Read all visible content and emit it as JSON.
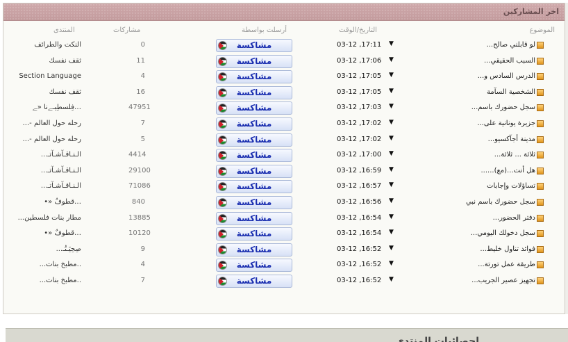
{
  "panel": {
    "title": "اخر المشاركين",
    "columns": {
      "topic": "الموضوع",
      "datetime": "التاريخ/الوقت",
      "posted_by": "أرسلت بواسطة",
      "posts": "مشاركات",
      "forum": "المنتدى"
    },
    "rows": [
      {
        "topic": "لو قابلني صالح...",
        "datetime": "03-12 ,17:11",
        "user": "مشاكسة",
        "posts": "0",
        "forum": "النكت والطرائف"
      },
      {
        "topic": "السبب الحقيقي...",
        "datetime": "03-12 ,17:06",
        "user": "مشاكسة",
        "posts": "11",
        "forum": "ثقف نفسك"
      },
      {
        "topic": "الدرس السادس و...",
        "datetime": "03-12 ,17:05",
        "user": "مشاكسة",
        "posts": "4",
        "forum": "Section Language"
      },
      {
        "topic": "الشخصية السآمة",
        "datetime": "03-12 ,17:05",
        "user": "مشاكسة",
        "posts": "16",
        "forum": "ثقف نفسك"
      },
      {
        "topic": "سجل حضورك باسم...",
        "datetime": "03-12 ,17:03",
        "user": "مشاكسة",
        "posts": "47951",
        "forum": "…فِلسطِيـﮯنا «ﮯ"
      },
      {
        "topic": "جزيرة يونانية على...",
        "datetime": "03-12 ,17:02",
        "user": "مشاكسة",
        "posts": "7",
        "forum": "رحله حول العالم -..."
      },
      {
        "topic": "مدينة أجآكسيو...",
        "datetime": "03-12 ,17:02",
        "user": "مشاكسة",
        "posts": "5",
        "forum": "رحله حول العالم -..."
      },
      {
        "topic": "ثلاثة ... ثلاثة...",
        "datetime": "03-12 ,17:00",
        "user": "مشاكسة",
        "posts": "4414",
        "forum": "الـنـاقـآشـآتـ..."
      },
      {
        "topic": "هل أنت...(مع)......",
        "datetime": "03-12 ,16:59",
        "user": "مشاكسة",
        "posts": "29100",
        "forum": "الـنـاقـآشـآتـ..."
      },
      {
        "topic": "تساؤلات وإجابات",
        "datetime": "03-12 ,16:57",
        "user": "مشاكسة",
        "posts": "71086",
        "forum": "الـنـاقـآشـآتـ..."
      },
      {
        "topic": "سجل حضورك باسم نبي",
        "datetime": "03-12 ,16:56",
        "user": "مشاكسة",
        "posts": "840",
        "forum": "…قطوفٌ «•"
      },
      {
        "topic": "دفتر الحضور...",
        "datetime": "03-12 ,16:54",
        "user": "مشاكسة",
        "posts": "13885",
        "forum": "مطار بنات فلسطين..."
      },
      {
        "topic": "سجل دخولك اليومي...",
        "datetime": "03-12 ,16:54",
        "user": "مشاكسة",
        "posts": "10120",
        "forum": "…قطوفٌ «•"
      },
      {
        "topic": "فوائد تناول خليط...",
        "datetime": "03-12 ,16:52",
        "user": "مشاكسة",
        "posts": "9",
        "forum": "صِحِيَـتُـ..."
      },
      {
        "topic": "طريقة عمل تورتة...",
        "datetime": "03-12 ,16:52",
        "user": "مشاكسة",
        "posts": "4",
        "forum": "..مطبخ بنات..."
      },
      {
        "topic": "تجهيز عصير الجريب...",
        "datetime": "03-12 ,16:52",
        "user": "مشاكسة",
        "posts": "7",
        "forum": "..مطبخ بنات..."
      }
    ]
  },
  "footer": {
    "title": "احصائيات المنتدى"
  },
  "colors": {
    "header_bg": "#c8a3a5",
    "button_text": "#1a2eb0",
    "panel_bg": "#fafaf6"
  },
  "icons": {
    "topic": "folder-icon",
    "arrow": "dropdown-arrow-icon",
    "user_flag": "palestine-flag-icon"
  }
}
